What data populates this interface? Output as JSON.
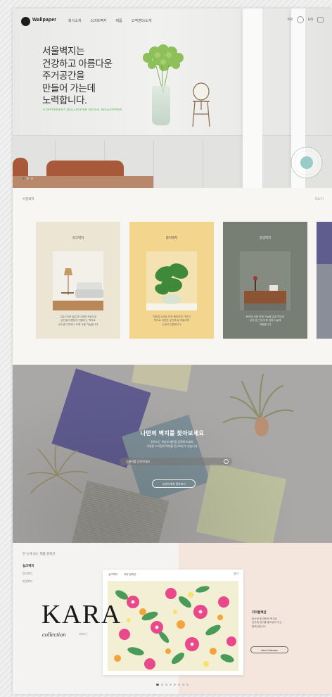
{
  "header": {
    "logo_text": "Wallpaper",
    "menu": [
      "회사소개",
      "스마트벽지",
      "제품",
      "고객센터/소개"
    ],
    "utilities": [
      "KR",
      "EN"
    ]
  },
  "hero": {
    "headline_lines": [
      "서울벽지는",
      "건강하고 아름다운",
      "주거공간을",
      "만들어 가는데",
      "노력합니다."
    ],
    "subline": "A DIFFERENT WALLPAPER SEOUL WALLPAPER",
    "accent_color": "#53b857"
  },
  "products": {
    "section_label": "서울벽지",
    "more": "더보기",
    "cards": [
      {
        "title": "실크벽지",
        "desc": [
          "고급스러운 질감과 다양한 색상으로",
          "공간을 아름답게 연출하는 벽지로",
          "내구성이 뛰어나 오래 사용 가능합니다"
        ],
        "bg": "#ece5d4"
      },
      {
        "title": "합지벽지",
        "desc": [
          "친환경 소재로 만든 합리적인 가격의",
          "벽지로 다양한 공간에 잘 어울리며",
          "시공이 간편합니다"
        ],
        "bg": "#f3d58e"
      },
      {
        "title": "방염벽지",
        "desc": [
          "화재에 강한 방염 기능을 갖춘 벽지로",
          "상업 공간 및 다중 이용 시설에",
          "적합합니다"
        ],
        "bg": "#777e74"
      }
    ]
  },
  "find": {
    "title": "나만의 벽지를 찾아보세요",
    "desc": [
      "원하시는 색상과 패턴을 검색해 보세요.",
      "다양한 스타일의 벽지를 만나보실 수 있습니다."
    ],
    "search_placeholder": "검색어를 입력하세요",
    "button": "나만의 벽지 찾아보기"
  },
  "kara": {
    "section_label": "한 눈에 보는 제품 컬렉션",
    "subnav_title": "실크벽지",
    "subnav_items": [
      "합지벽지",
      "방염벽지"
    ],
    "title": "KARA",
    "subtitle": "collection",
    "more": "더보기",
    "panel_tabs": [
      "실크벽지",
      "카라 컬렉션"
    ],
    "panel_close": "닫기",
    "info_title": "카라컬렉션",
    "info_desc": [
      "화사한 꽃 패턴의 벽지로",
      "공간에 생기를 불어넣어 주는",
      "컬렉션입니다"
    ],
    "info_button": "View Collection"
  }
}
